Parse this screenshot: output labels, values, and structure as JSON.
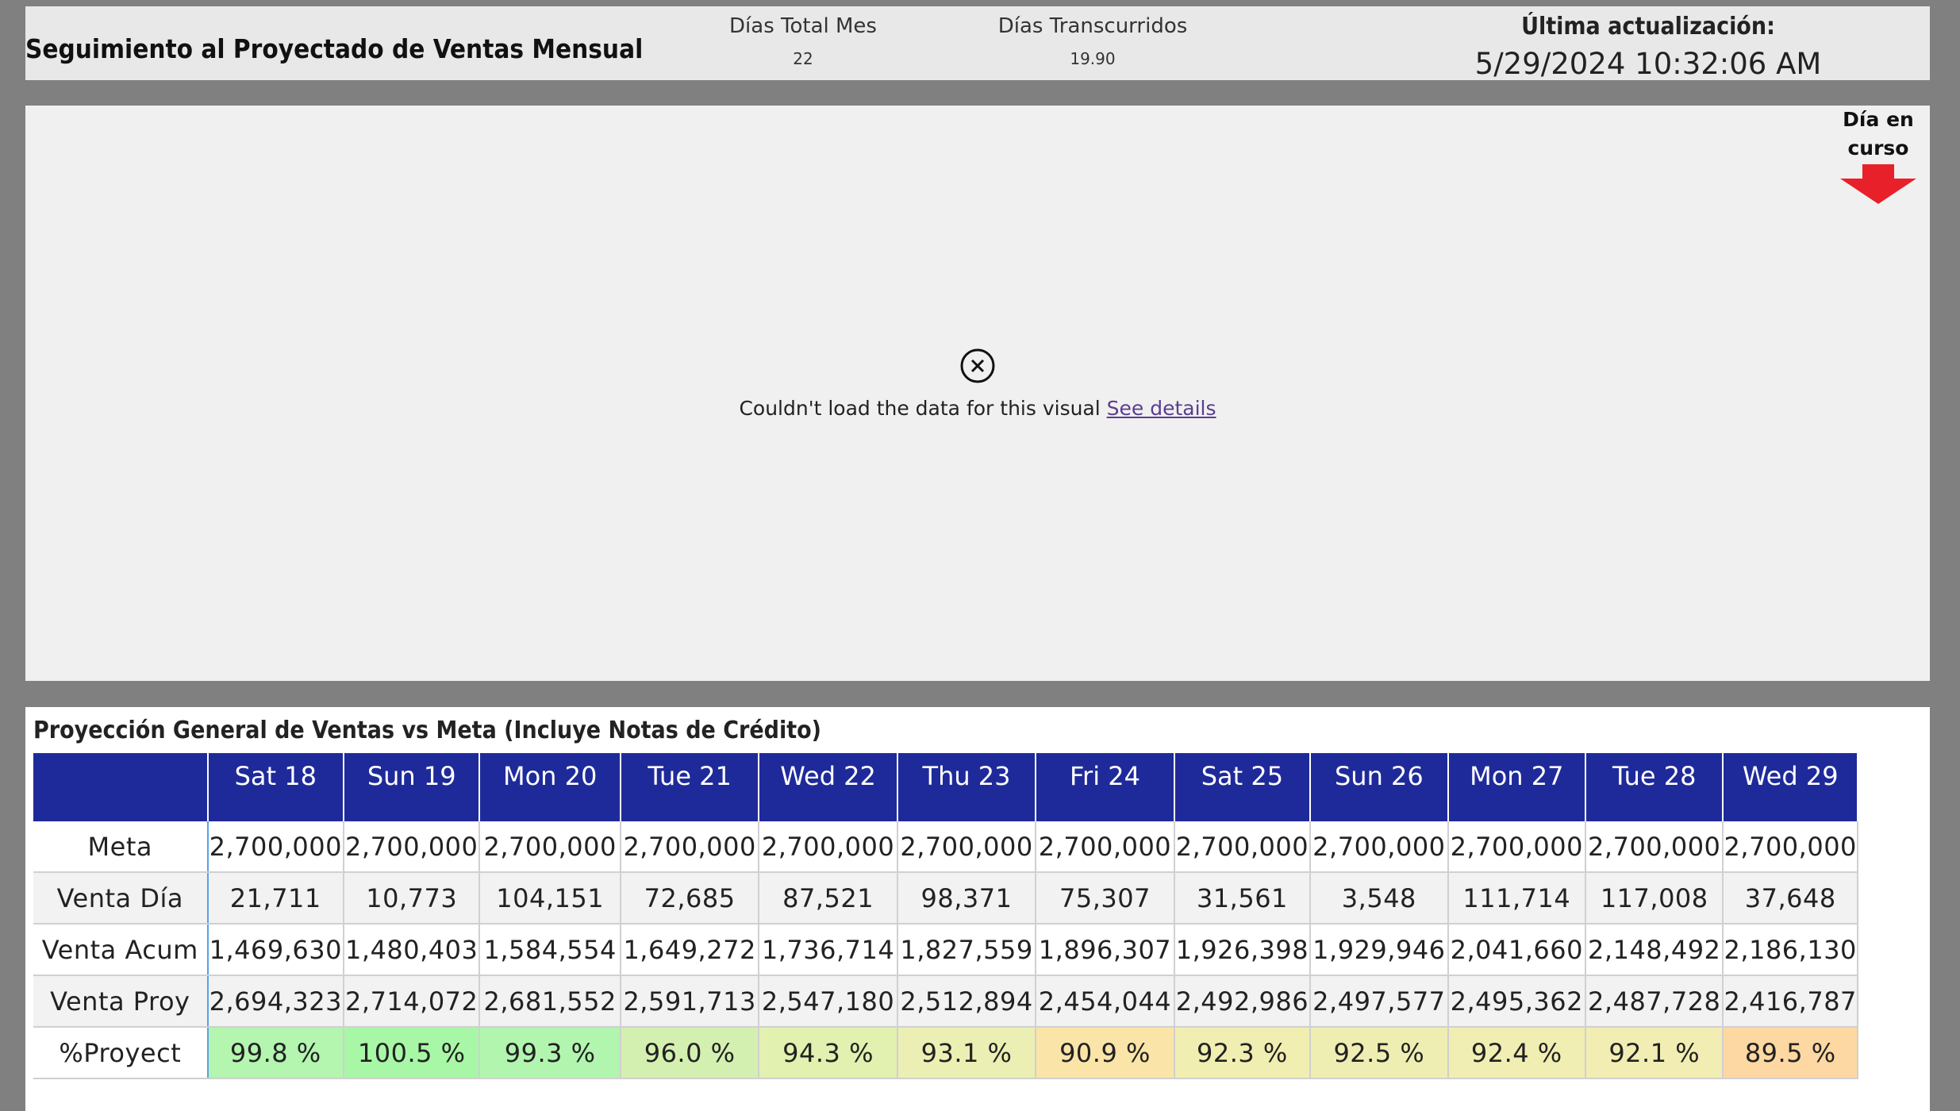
{
  "header": {
    "title": "Seguimiento al Proyectado de Ventas Mensual",
    "dias_total_label": "Días Total Mes",
    "dias_total_value": "22",
    "dias_transcurridos_label": "Días Transcurridos",
    "dias_transcurridos_value": "19.90",
    "update_label": "Última actualización:",
    "update_value": "5/29/2024 10:32:06 AM"
  },
  "visual": {
    "day_marker_line1": "Día en",
    "day_marker_line2": "curso",
    "error_message": "Couldn't load the data for this visual",
    "error_link": "See details",
    "colors": {
      "arrow": "#e8202a"
    }
  },
  "table": {
    "title": "Proyección General de Ventas vs Meta (Incluye Notas de Crédito)",
    "columns": [
      "Sat 18",
      "Sun 19",
      "Mon 20",
      "Tue 21",
      "Wed 22",
      "Thu 23",
      "Fri 24",
      "Sat 25",
      "Sun 26",
      "Mon 27",
      "Tue 28",
      "Wed 29"
    ],
    "rows": [
      {
        "label": "Meta",
        "values": [
          "2,700,000",
          "2,700,000",
          "2,700,000",
          "2,700,000",
          "2,700,000",
          "2,700,000",
          "2,700,000",
          "2,700,000",
          "2,700,000",
          "2,700,000",
          "2,700,000",
          "2,700,000"
        ]
      },
      {
        "label": "Venta Día",
        "values": [
          "21,711",
          "10,773",
          "104,151",
          "72,685",
          "87,521",
          "98,371",
          "75,307",
          "31,561",
          "3,548",
          "111,714",
          "117,008",
          "37,648"
        ]
      },
      {
        "label": "Venta Acum",
        "values": [
          "1,469,630",
          "1,480,403",
          "1,584,554",
          "1,649,272",
          "1,736,714",
          "1,827,559",
          "1,896,307",
          "1,926,398",
          "1,929,946",
          "2,041,660",
          "2,148,492",
          "2,186,130"
        ]
      },
      {
        "label": "Venta Proy",
        "values": [
          "2,694,323",
          "2,714,072",
          "2,681,552",
          "2,591,713",
          "2,547,180",
          "2,512,894",
          "2,454,044",
          "2,492,986",
          "2,497,577",
          "2,495,362",
          "2,487,728",
          "2,416,787"
        ]
      },
      {
        "label": "%Proyect",
        "values": [
          "99.8 %",
          "100.5 %",
          "99.3 %",
          "96.0 %",
          "94.3 %",
          "93.1 %",
          "90.9 %",
          "92.3 %",
          "92.5 %",
          "92.4 %",
          "92.1 %",
          "89.5 %"
        ],
        "colors": [
          "#b4f5b0",
          "#a8f7a6",
          "#b2f5af",
          "#d4f0b0",
          "#e2f0b0",
          "#ecefb4",
          "#fbe4a8",
          "#f1eeb2",
          "#efeeb2",
          "#f0eeb2",
          "#f2edb2",
          "#fdd8a2"
        ]
      }
    ],
    "colors": {
      "header_bg": "#1f2a9a",
      "header_text": "#ffffff"
    }
  }
}
